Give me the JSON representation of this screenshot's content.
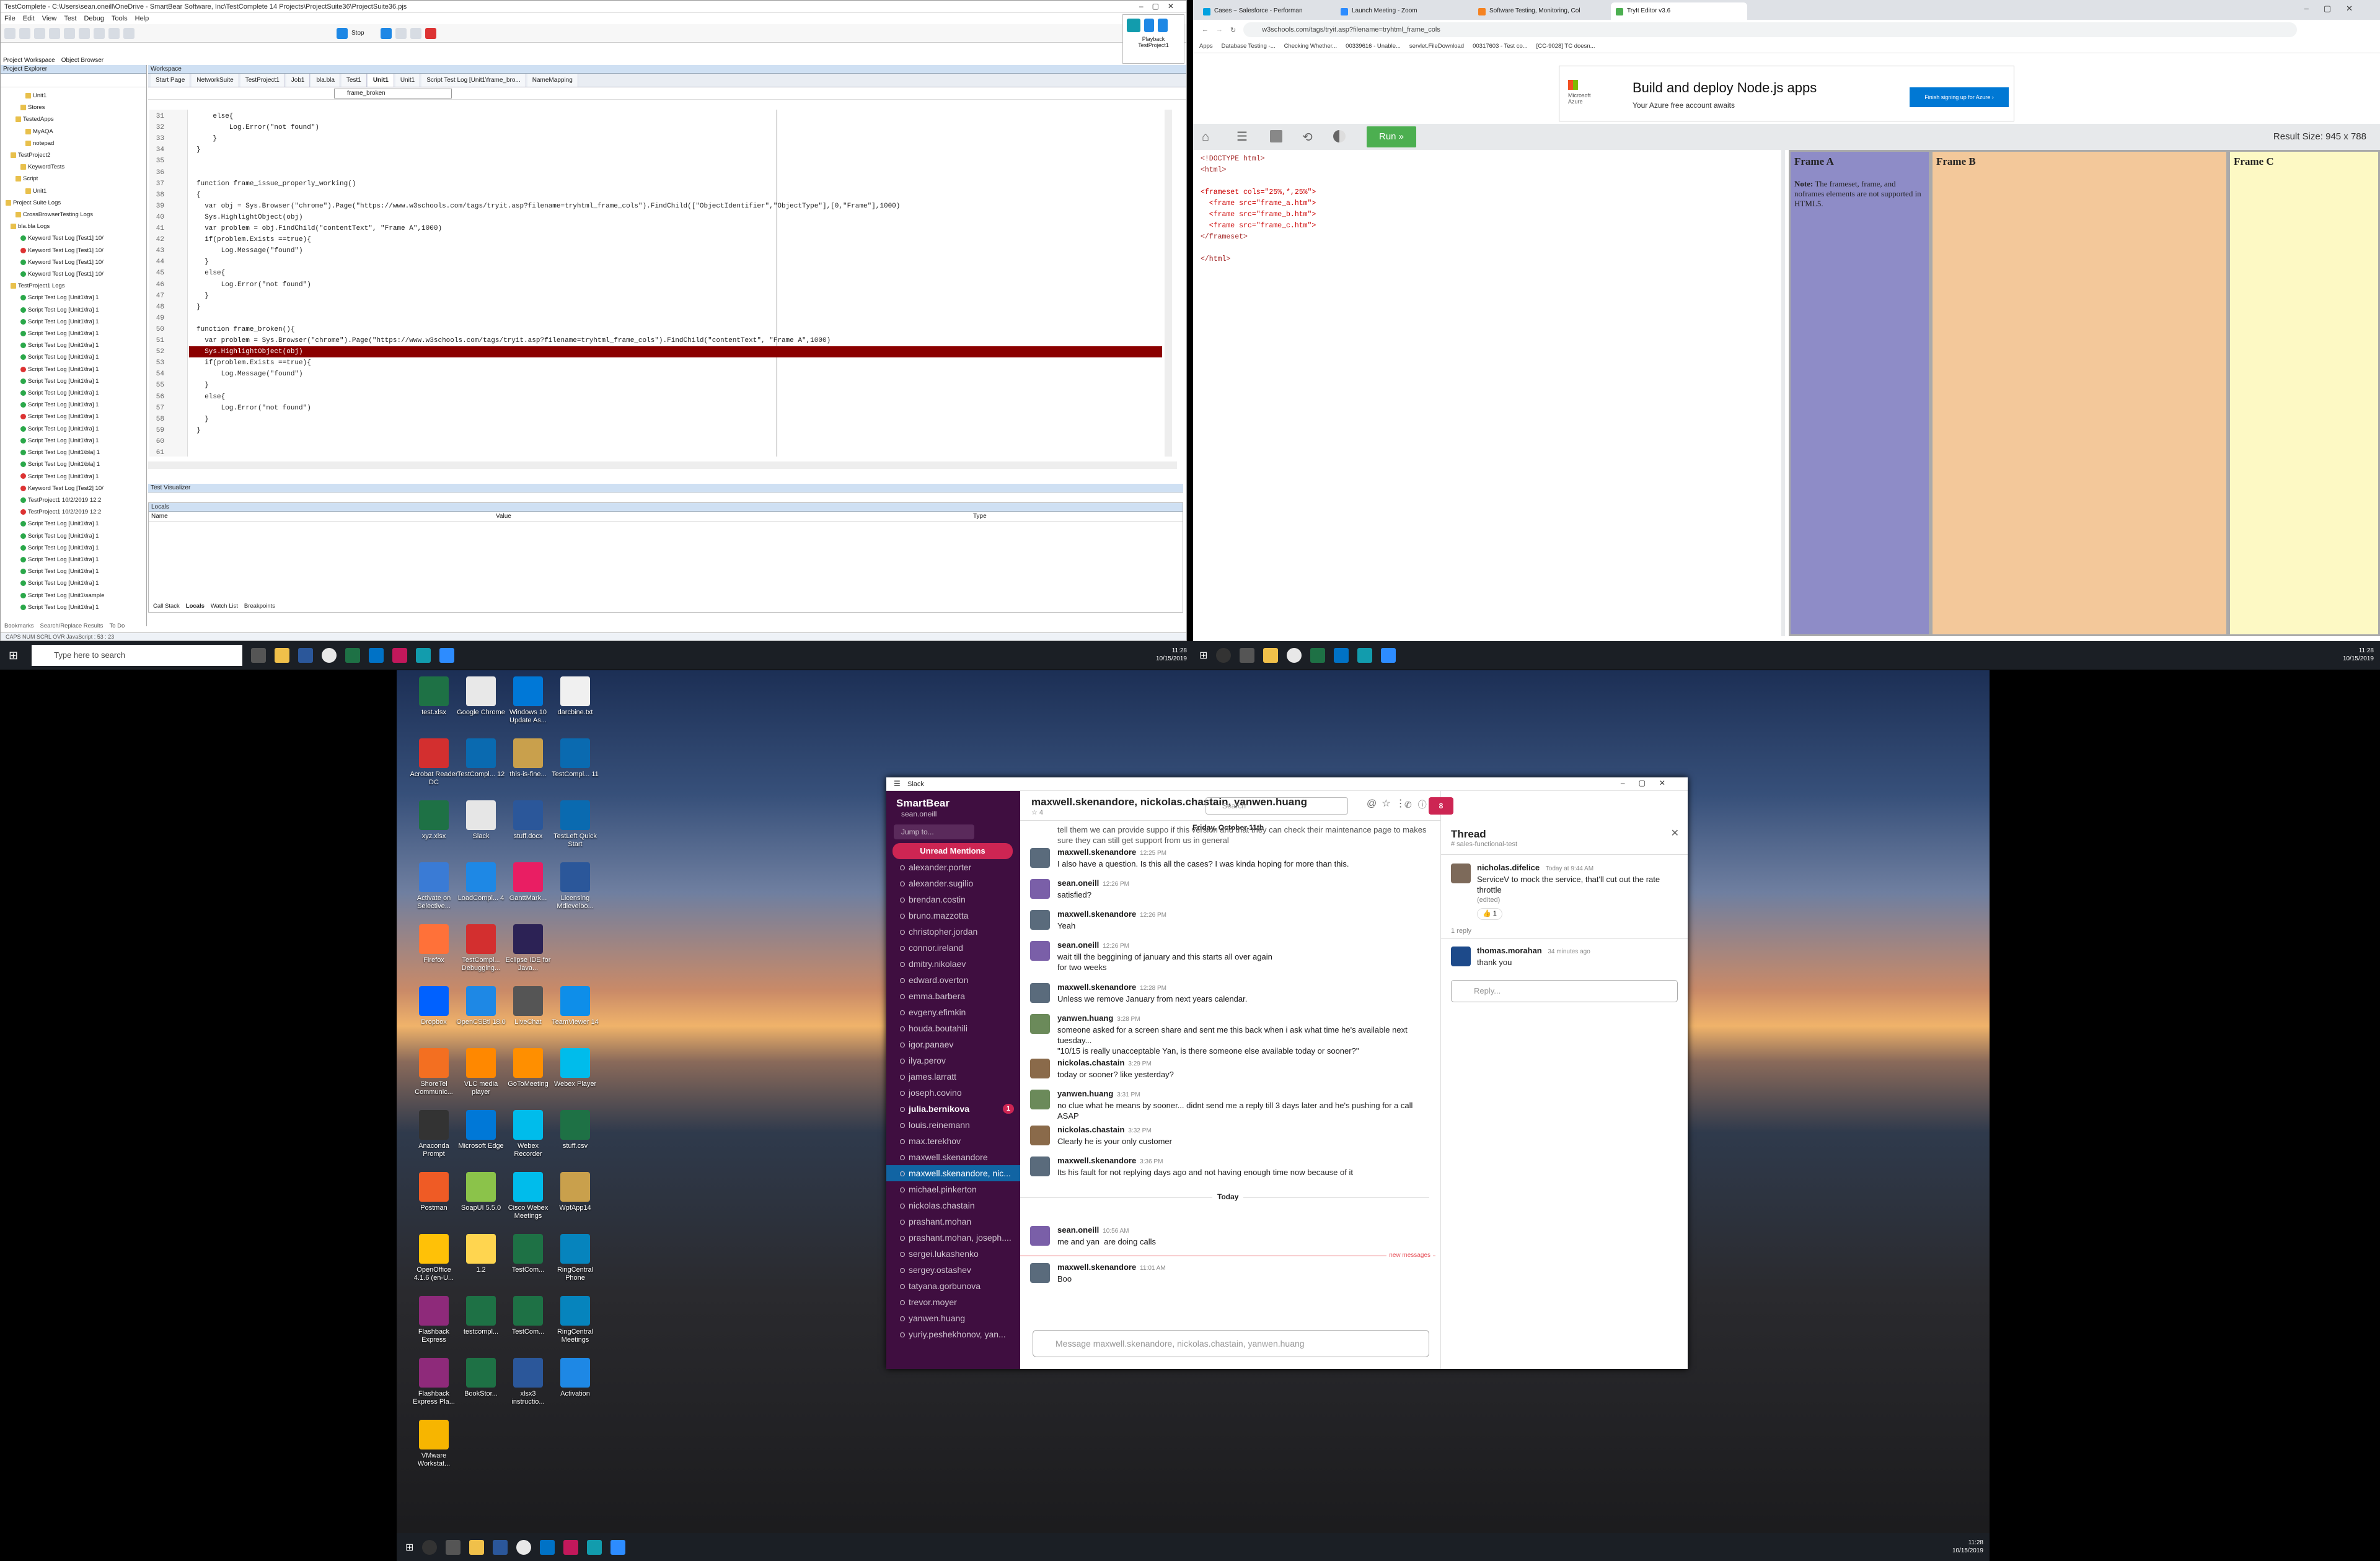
{
  "testcomplete": {
    "title": "TestComplete - C:\\Users\\sean.oneill\\OneDrive - SmartBear Software, Inc\\TestComplete 14 Projects\\ProjectSuite36\\ProjectSuite36.pjs",
    "menu": [
      "File",
      "Edit",
      "View",
      "Test",
      "Debug",
      "Tools",
      "Help"
    ],
    "stop_label": "Stop",
    "project_tabs": [
      "Project Workspace",
      "Object Browser"
    ],
    "explorer_title": "Project Explorer",
    "workspace_title": "Workspace",
    "tree": [
      {
        "t": "Unit1",
        "s": "f",
        "i": 5
      },
      {
        "t": "Stores",
        "s": "f",
        "i": 4
      },
      {
        "t": "TestedApps",
        "s": "f",
        "i": 3
      },
      {
        "t": "MyAQA",
        "s": "f",
        "i": 5
      },
      {
        "t": "notepad",
        "s": "f",
        "i": 5
      },
      {
        "t": "TestProject2",
        "s": "f",
        "i": 2
      },
      {
        "t": "KeywordTests",
        "s": "f",
        "i": 4
      },
      {
        "t": "Script",
        "s": "f",
        "i": 3
      },
      {
        "t": "Unit1",
        "s": "f",
        "i": 5
      },
      {
        "t": "Project Suite Logs",
        "s": "f",
        "i": 1
      },
      {
        "t": "CrossBrowserTesting Logs",
        "s": "f",
        "i": 3
      },
      {
        "t": "bla.bla Logs",
        "s": "f",
        "i": 2
      },
      {
        "t": "Keyword Test Log [Test1] 10/",
        "s": "g",
        "i": 4
      },
      {
        "t": "Keyword Test Log [Test1] 10/",
        "s": "r",
        "i": 4
      },
      {
        "t": "Keyword Test Log [Test1] 10/",
        "s": "g",
        "i": 4
      },
      {
        "t": "Keyword Test Log [Test1] 10/",
        "s": "g",
        "i": 4
      },
      {
        "t": "TestProject1 Logs",
        "s": "f",
        "i": 2
      },
      {
        "t": "Script Test Log [Unit1\\fra] 1",
        "s": "g",
        "i": 4
      },
      {
        "t": "Script Test Log [Unit1\\fra] 1",
        "s": "g",
        "i": 4
      },
      {
        "t": "Script Test Log [Unit1\\fra] 1",
        "s": "g",
        "i": 4
      },
      {
        "t": "Script Test Log [Unit1\\fra] 1",
        "s": "g",
        "i": 4
      },
      {
        "t": "Script Test Log [Unit1\\fra] 1",
        "s": "g",
        "i": 4
      },
      {
        "t": "Script Test Log [Unit1\\fra] 1",
        "s": "g",
        "i": 4
      },
      {
        "t": "Script Test Log [Unit1\\fra] 1",
        "s": "r",
        "i": 4
      },
      {
        "t": "Script Test Log [Unit1\\fra] 1",
        "s": "g",
        "i": 4
      },
      {
        "t": "Script Test Log [Unit1\\fra] 1",
        "s": "g",
        "i": 4
      },
      {
        "t": "Script Test Log [Unit1\\fra] 1",
        "s": "g",
        "i": 4
      },
      {
        "t": "Script Test Log [Unit1\\fra] 1",
        "s": "r",
        "i": 4
      },
      {
        "t": "Script Test Log [Unit1\\fra] 1",
        "s": "g",
        "i": 4
      },
      {
        "t": "Script Test Log [Unit1\\fra] 1",
        "s": "g",
        "i": 4
      },
      {
        "t": "Script Test Log [Unit1\\bla] 1",
        "s": "g",
        "i": 4
      },
      {
        "t": "Script Test Log [Unit1\\bla] 1",
        "s": "g",
        "i": 4
      },
      {
        "t": "Script Test Log [Unit1\\fra] 1",
        "s": "r",
        "i": 4
      },
      {
        "t": "Keyword Test Log [Test2] 10/",
        "s": "r",
        "i": 4
      },
      {
        "t": "TestProject1 10/2/2019 12:2",
        "s": "g",
        "i": 4
      },
      {
        "t": "TestProject1 10/2/2019 12:2",
        "s": "r",
        "i": 4
      },
      {
        "t": "Script Test Log [Unit1\\fra] 1",
        "s": "g",
        "i": 4
      },
      {
        "t": "Script Test Log [Unit1\\fra] 1",
        "s": "g",
        "i": 4
      },
      {
        "t": "Script Test Log [Unit1\\fra] 1",
        "s": "g",
        "i": 4
      },
      {
        "t": "Script Test Log [Unit1\\fra] 1",
        "s": "g",
        "i": 4
      },
      {
        "t": "Script Test Log [Unit1\\fra] 1",
        "s": "g",
        "i": 4
      },
      {
        "t": "Script Test Log [Unit1\\fra] 1",
        "s": "g",
        "i": 4
      },
      {
        "t": "Script Test Log [Unit1\\sample",
        "s": "g",
        "i": 4
      },
      {
        "t": "Script Test Log [Unit1\\fra] 1",
        "s": "g",
        "i": 4
      }
    ],
    "tabs": [
      "Start Page",
      "NetworkSuite",
      "TestProject1",
      "Job1",
      "bla.bla",
      "Test1",
      "Unit1",
      "Unit1",
      "Script Test Log [Unit1\\frame_bro...",
      "NameMapping"
    ],
    "routine": "frame_broken",
    "code": [
      {
        "n": "31",
        "c": "    else{"
      },
      {
        "n": "32",
        "c": "        Log.Error(\"not found\")"
      },
      {
        "n": "33",
        "c": "    }"
      },
      {
        "n": "34",
        "c": "}"
      },
      {
        "n": "35",
        "c": ""
      },
      {
        "n": "36",
        "c": ""
      },
      {
        "n": "37",
        "c": "function frame_issue_properly_working()"
      },
      {
        "n": "38",
        "c": "{"
      },
      {
        "n": "39",
        "c": "  var obj = Sys.Browser(\"chrome\").Page(\"https://www.w3schools.com/tags/tryit.asp?filename=tryhtml_frame_cols\").FindChild([\"ObjectIdentifier\",\"ObjectType\"],[0,\"Frame\"],1000)"
      },
      {
        "n": "40",
        "c": "  Sys.HighlightObject(obj)"
      },
      {
        "n": "41",
        "c": "  var problem = obj.FindChild(\"contentText\", \"Frame A\",1000)"
      },
      {
        "n": "42",
        "c": "  if(problem.Exists ==true){"
      },
      {
        "n": "43",
        "c": "      Log.Message(\"found\")"
      },
      {
        "n": "44",
        "c": "  }"
      },
      {
        "n": "45",
        "c": "  else{"
      },
      {
        "n": "46",
        "c": "      Log.Error(\"not found\")"
      },
      {
        "n": "47",
        "c": "  }"
      },
      {
        "n": "48",
        "c": "}"
      },
      {
        "n": "49",
        "c": ""
      },
      {
        "n": "50",
        "c": "function frame_broken(){"
      },
      {
        "n": "51",
        "c": "  var problem = Sys.Browser(\"chrome\").Page(\"https://www.w3schools.com/tags/tryit.asp?filename=tryhtml_frame_cols\").FindChild(\"contentText\", \"Frame A\",1000)"
      },
      {
        "n": "52",
        "c": "  Sys.HighlightObject(obj)"
      },
      {
        "n": "53",
        "c": "  if(problem.Exists ==true){"
      },
      {
        "n": "54",
        "c": "      Log.Message(\"found\")"
      },
      {
        "n": "55",
        "c": "  }"
      },
      {
        "n": "56",
        "c": "  else{"
      },
      {
        "n": "57",
        "c": "      Log.Error(\"not found\")"
      },
      {
        "n": "58",
        "c": "  }"
      },
      {
        "n": "59",
        "c": "}"
      },
      {
        "n": "60",
        "c": ""
      },
      {
        "n": "61",
        "c": ""
      }
    ],
    "highlight_line": "52",
    "visualizer_title": "Test Visualizer",
    "locals_title": "Locals",
    "locals_cols": [
      "Name",
      "Value",
      "Type"
    ],
    "bottom_tabs": [
      "Call Stack",
      "Locals",
      "Watch List",
      "Breakpoints"
    ],
    "left_bottom_tabs": [
      "Bookmarks",
      "Search/Replace Results",
      "To Do"
    ],
    "status": "CAPS  NUM  SCRL  OVR   JavaScript : 53 : 23",
    "playback": "Playback",
    "playback_sub": "TestProject1"
  },
  "chrome": {
    "tabs": [
      {
        "label": "Cases ~ Salesforce - Performan",
        "c": "#00a1e0"
      },
      {
        "label": "Launch Meeting - Zoom",
        "c": "#2d8cff"
      },
      {
        "label": "Software Testing, Monitoring, Col",
        "c": "#f58220"
      },
      {
        "label": "TryIt Editor v3.6",
        "c": "#4caf50"
      }
    ],
    "url": "w3schools.com/tags/tryit.asp?filename=tryhtml_frame_cols",
    "bookmarks": [
      "Apps",
      "Database Testing -...",
      "Checking Whether...",
      "00339616 - Unable...",
      "servlet.FileDownload",
      "00317603 - Test co...",
      "[CC-9028] TC doesn..."
    ],
    "ad": {
      "brand": "Microsoft Azure",
      "headline": "Build and deploy Node.js apps",
      "sub": "Your Azure free account awaits",
      "cta": "Finish signing up for Azure ›"
    },
    "run": "Run »",
    "result_size": "Result Size: 945 x 788",
    "source": [
      "<!DOCTYPE html>",
      "<html>",
      "",
      "<frameset cols=\"25%,*,25%\">",
      "  <frame src=\"frame_a.htm\">",
      "  <frame src=\"frame_b.htm\">",
      "  <frame src=\"frame_c.htm\">",
      "</frameset>",
      "",
      "</html>"
    ],
    "frames": [
      {
        "title": "Frame A",
        "note_b": "Note:",
        "note": " The frameset, frame, and noframes elements are not supported in HTML5.",
        "bg": "#8e8cc7"
      },
      {
        "title": "Frame B",
        "bg": "#f3c89a"
      },
      {
        "title": "Frame C",
        "bg": "#fdf9c4"
      }
    ]
  },
  "taskbar_top": {
    "search": "Type here to search",
    "time": "11:28",
    "date": "10/15/2019"
  },
  "taskbar_right": {
    "time": "11:28",
    "date": "10/15/2019"
  },
  "taskbar_bottom": {
    "time": "11:28",
    "date": "10/15/2019"
  },
  "desktop": [
    {
      "l": "test.xlsx",
      "c": "#1e7145"
    },
    {
      "l": "Google Chrome",
      "c": "#e8e8e8"
    },
    {
      "l": "Windows 10 Update As...",
      "c": "#0078d7"
    },
    {
      "l": "darcbine.txt",
      "c": "#f0f0f0"
    },
    {
      "l": "Acrobat Reader DC",
      "c": "#d32f2f"
    },
    {
      "l": "TestCompl... 12",
      "c": "#0a6ab0"
    },
    {
      "l": "this-is-fine...",
      "c": "#c9a04c"
    },
    {
      "l": "TestCompl... 11",
      "c": "#0a6ab0"
    },
    {
      "l": "xyz.xlsx",
      "c": "#1e7145"
    },
    {
      "l": "Slack",
      "c": "#e6e6e6"
    },
    {
      "l": "stuff.docx",
      "c": "#2b579a"
    },
    {
      "l": "TestLeft Quick Start",
      "c": "#0a6ab0"
    },
    {
      "l": "Activate on Selective...",
      "c": "#3a7bd5"
    },
    {
      "l": "LoadCompl... 4",
      "c": "#1e88e5"
    },
    {
      "l": "GanttMark...",
      "c": "#e91e63"
    },
    {
      "l": "Licensing Mdlevelbo...",
      "c": "#2b579a"
    },
    {
      "l": "Firefox",
      "c": "#ff7139"
    },
    {
      "l": "TestCompl... Debugging...",
      "c": "#d32f2f"
    },
    {
      "l": "Eclipse IDE for Java...",
      "c": "#2c2255"
    },
    {
      "l": "",
      "c": "transparent"
    },
    {
      "l": "Dropbox",
      "c": "#0061ff"
    },
    {
      "l": "OpenCSBtl 18.0",
      "c": "#1e88e5"
    },
    {
      "l": "LiveChat",
      "c": "#555"
    },
    {
      "l": "TeamViewer 14",
      "c": "#0e8ee9"
    },
    {
      "l": "ShoreTel Communic...",
      "c": "#f36f21"
    },
    {
      "l": "VLC media player",
      "c": "#ff8800"
    },
    {
      "l": "GoToMeeting",
      "c": "#ff8f00"
    },
    {
      "l": "Webex Player",
      "c": "#00bceb"
    },
    {
      "l": "Anaconda Prompt",
      "c": "#333"
    },
    {
      "l": "Microsoft Edge",
      "c": "#0078d7"
    },
    {
      "l": "Webex Recorder",
      "c": "#00bceb"
    },
    {
      "l": "stuff.csv",
      "c": "#1e7145"
    },
    {
      "l": "Postman",
      "c": "#ef5b25"
    },
    {
      "l": "SoapUI 5.5.0",
      "c": "#8bc34a"
    },
    {
      "l": "Cisco Webex Meetings",
      "c": "#00bceb"
    },
    {
      "l": "WpfApp14",
      "c": "#c9a04c"
    },
    {
      "l": "OpenOffice 4.1.6 (en-U...",
      "c": "#ffc107"
    },
    {
      "l": "1.2",
      "c": "#ffd54f"
    },
    {
      "l": "TestCom...",
      "c": "#1e7145"
    },
    {
      "l": "RingCentral Phone",
      "c": "#0684bd"
    },
    {
      "l": "Flashback Express",
      "c": "#8e2a7a"
    },
    {
      "l": "testcompl...",
      "c": "#1e7145"
    },
    {
      "l": "TestCom...",
      "c": "#1e7145"
    },
    {
      "l": "RingCentral Meetings",
      "c": "#0684bd"
    },
    {
      "l": "Flashback Express Pla...",
      "c": "#8e2a7a"
    },
    {
      "l": "BookStor...",
      "c": "#1e7145"
    },
    {
      "l": "xlsx3 instructio...",
      "c": "#2b579a"
    },
    {
      "l": "Activation",
      "c": "#1e88e5"
    },
    {
      "l": "VMware Workstat...",
      "c": "#f7b500"
    },
    {
      "l": "",
      "c": "transparent"
    },
    {
      "l": "",
      "c": "transparent"
    },
    {
      "l": "",
      "c": "transparent"
    }
  ],
  "slack": {
    "window_title": "Slack",
    "workspace": "SmartBear",
    "user": "sean.oneill",
    "jump": "Jump to...",
    "unread": "Unread Mentions",
    "channels": [
      {
        "n": "alexander.porter",
        "s": ""
      },
      {
        "n": "alexander.sugilio",
        "s": ""
      },
      {
        "n": "brendan.costin",
        "s": ""
      },
      {
        "n": "bruno.mazzotta",
        "s": ""
      },
      {
        "n": "christopher.jordan",
        "s": ""
      },
      {
        "n": "connor.ireland",
        "s": ""
      },
      {
        "n": "dmitry.nikolaev",
        "s": ""
      },
      {
        "n": "edward.overton",
        "s": ""
      },
      {
        "n": "emma.barbera",
        "s": ""
      },
      {
        "n": "evgeny.efimkin",
        "s": ""
      },
      {
        "n": "houda.boutahili",
        "s": ""
      },
      {
        "n": "igor.panaev",
        "s": ""
      },
      {
        "n": "ilya.perov",
        "s": ""
      },
      {
        "n": "james.larratt",
        "s": ""
      },
      {
        "n": "joseph.covino",
        "s": ""
      },
      {
        "n": "julia.bernikova",
        "s": "bold",
        "badge": "1"
      },
      {
        "n": "louis.reinemann",
        "s": ""
      },
      {
        "n": "max.terekhov",
        "s": ""
      },
      {
        "n": "maxwell.skenandore",
        "s": ""
      },
      {
        "n": "maxwell.skenandore, nic...",
        "s": "sel"
      },
      {
        "n": "michael.pinkerton",
        "s": ""
      },
      {
        "n": "nickolas.chastain",
        "s": ""
      },
      {
        "n": "prashant.mohan",
        "s": ""
      },
      {
        "n": "prashant.mohan, joseph....",
        "s": ""
      },
      {
        "n": "sergei.lukashenko",
        "s": ""
      },
      {
        "n": "sergey.ostashev",
        "s": ""
      },
      {
        "n": "tatyana.gorbunova",
        "s": ""
      },
      {
        "n": "trevor.moyer",
        "s": ""
      },
      {
        "n": "yanwen.huang",
        "s": ""
      },
      {
        "n": "yuriy.peshekhonov, yan...",
        "s": ""
      }
    ],
    "conv_title": "maxwell.skenandore, nickolas.chastain, yanwen.huang",
    "members": "4",
    "search": "Search",
    "badge": "8",
    "date_div": "Friday, October 11th",
    "top_partial": "tell them we can provide suppo       if this version and that they can check their maintenance page to makes sure they can still get support from us in general",
    "messages": [
      {
        "name": "maxwell.skenandore",
        "time": "12:25 PM",
        "text": "I also have a question. Is this all the cases? I was kinda hoping for more than this."
      },
      {
        "name": "sean.oneill",
        "time": "12:26 PM",
        "text": "satisfied?"
      },
      {
        "name": "maxwell.skenandore",
        "time": "12:26 PM",
        "text": "Yeah"
      },
      {
        "name": "sean.oneill",
        "time": "12:26 PM",
        "text": "wait till the beggining of january and this starts all over again\nfor two weeks"
      },
      {
        "name": "maxwell.skenandore",
        "time": "12:28 PM",
        "text": "Unless we remove January from next years calendar."
      },
      {
        "name": "yanwen.huang",
        "time": "3:28 PM",
        "text": "someone asked for a screen share and sent me this back when i ask what time he's available next tuesday...\n\"10/15 is really unacceptable Yan, is there someone else available today or sooner?\""
      },
      {
        "name": "nickolas.chastain",
        "time": "3:29 PM",
        "text": "today or sooner? like yesterday?"
      },
      {
        "name": "yanwen.huang",
        "time": "3:31 PM",
        "text": "no clue what he means by sooner... didnt send me a reply till 3 days later and he's pushing for a call ASAP"
      },
      {
        "name": "nickolas.chastain",
        "time": "3:32 PM",
        "text": "Clearly he is your only customer"
      },
      {
        "name": "maxwell.skenandore",
        "time": "3:36 PM",
        "text": "Its his fault for not replying days ago and not having enough time now because of it"
      }
    ],
    "today": "Today",
    "today_messages": [
      {
        "name": "sean.oneill",
        "time": "10:56 AM",
        "text": "me and yan  are doing calls"
      },
      {
        "name": "maxwell.skenandore",
        "time": "11:01 AM",
        "text": "Boo"
      }
    ],
    "new_messages": "new messages",
    "composer": "Message maxwell.skenandore, nickolas.chastain, yanwen.huang",
    "thread": {
      "title": "Thread",
      "channel": "# sales-functional-test",
      "parent": {
        "name": "nicholas.difelice",
        "time": "Today at 9:44 AM",
        "text": "ServiceV to mock the service, that'll cut out the rate throttle",
        "edited": "(edited)",
        "reaction": "1"
      },
      "replies_count": "1 reply",
      "reply": {
        "name": "thomas.morahan",
        "time": "34 minutes ago",
        "text": "thank you"
      },
      "reply_placeholder": "Reply..."
    },
    "colors": {
      "sidebar": "#3f0e40",
      "selected": "#1164a3",
      "unread": "#cd2553"
    }
  }
}
